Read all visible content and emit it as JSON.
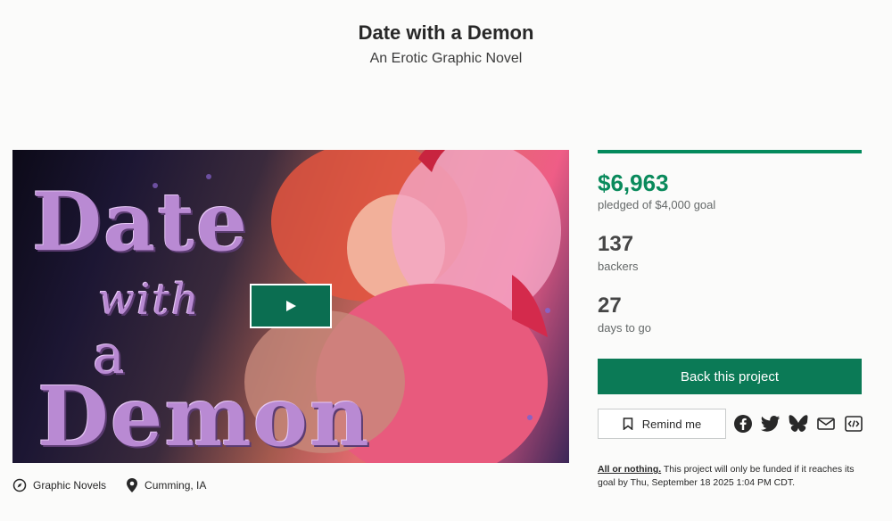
{
  "project": {
    "title": "Date with a Demon",
    "subtitle": "An Erotic Graphic Novel"
  },
  "video": {
    "cover_lines": [
      "Date",
      "with",
      "a",
      "Demon"
    ],
    "play_icon": "play-icon"
  },
  "meta": {
    "category": "Graphic Novels",
    "location": "Cumming, IA"
  },
  "stats": {
    "pledged": "$6,963",
    "pledged_label": "pledged of $4,000 goal",
    "backers": "137",
    "backers_label": "backers",
    "days": "27",
    "days_label": "days to go",
    "progress_fraction": 1.0
  },
  "actions": {
    "back_label": "Back this project",
    "remind_label": "Remind me",
    "social_icons": [
      "facebook-icon",
      "twitter-icon",
      "bluesky-icon",
      "email-icon",
      "embed-icon"
    ]
  },
  "funding_note": {
    "link": "All or nothing.",
    "text": " This project will only be funded if it reaches its goal by Thu, September 18 2025 1:04 PM CDT."
  },
  "colors": {
    "accent": "#0b7a56",
    "pledged": "#0a8a5c"
  }
}
